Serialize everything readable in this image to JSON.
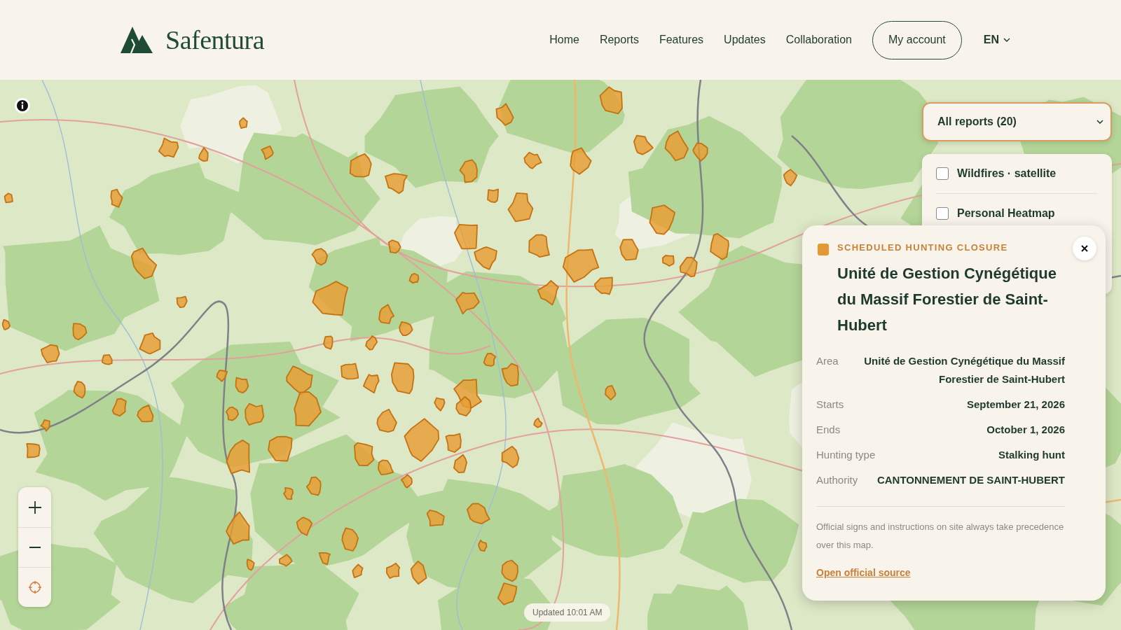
{
  "header": {
    "brand": "Safentura",
    "nav": [
      "Home",
      "Reports",
      "Features",
      "Updates",
      "Collaboration"
    ],
    "account_button": "My account",
    "language": "EN"
  },
  "map": {
    "report_filter": {
      "value": "All reports (20)"
    },
    "layers": [
      {
        "label": "Wildfires · satellite",
        "checked": false
      },
      {
        "label": "Personal Heatmap",
        "checked": false
      }
    ],
    "updated": "Updated 10:01 AM"
  },
  "popup": {
    "category": "SCHEDULED HUNTING CLOSURE",
    "title": "Unité de Gestion Cynégétique du Massif Forestier de Saint-Hubert",
    "details": [
      {
        "label": "Area",
        "value": "Unité de Gestion Cynégétique du Massif Forestier de Saint-Hubert"
      },
      {
        "label": "Starts",
        "value": "September 21, 2026"
      },
      {
        "label": "Ends",
        "value": "October 1, 2026"
      },
      {
        "label": "Hunting type",
        "value": "Stalking hunt"
      },
      {
        "label": "Authority",
        "value": "CANTONNEMENT DE SAINT-HUBERT"
      }
    ],
    "note": "Official signs and instructions on site always take precedence over this map.",
    "link": "Open official source"
  }
}
